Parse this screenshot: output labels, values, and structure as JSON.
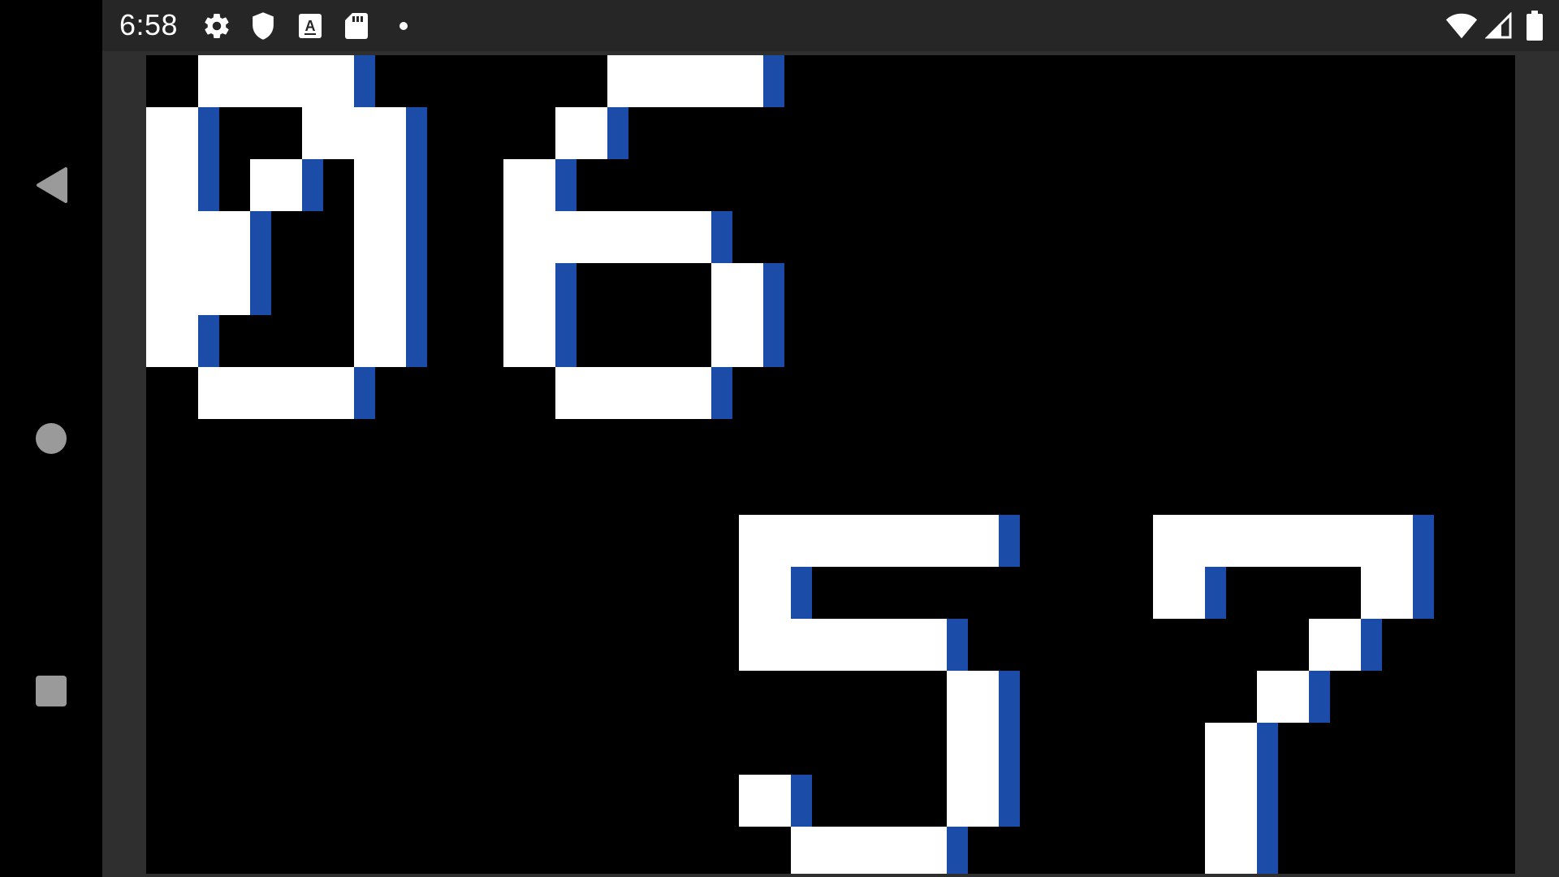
{
  "status_bar": {
    "time": "6:58",
    "left_icons": [
      "settings-icon",
      "shield-icon",
      "a-font-icon",
      "sd-card-icon",
      "dot-icon"
    ],
    "right_icons": [
      "wifi-icon",
      "signal-icon",
      "battery-icon"
    ]
  },
  "navigation": {
    "items": [
      "back",
      "home",
      "recents"
    ]
  },
  "clock": {
    "hours": "06",
    "minutes": "57",
    "colors": {
      "digit": "#ffffff",
      "shadow": "#1a4ca8",
      "background": "#000000"
    }
  }
}
